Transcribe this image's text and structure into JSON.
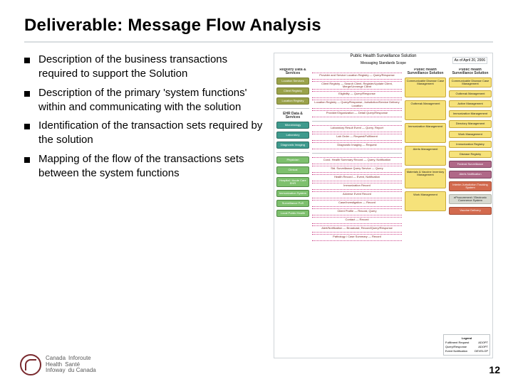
{
  "title": "Deliverable: Message Flow Analysis",
  "bullets": [
    "Description of the business transactions required to support the Solution",
    "Description of the primary 'system functions' within and communicating with the solution",
    "Identification of the transaction sets required by the solution",
    "Mapping of the flow of the transactions sets between the system functions"
  ],
  "diagram": {
    "date_box": "As of April 20, 2006",
    "heading": "Public Health Surveillance Solution",
    "subheading": "Messaging Standards Scope",
    "col1_header": "Registry Data & Services",
    "col3_header": "Public Health Surveillance Solution",
    "col1_blocks_a": [
      "Location Services",
      "Client Registry",
      "Location Registry"
    ],
    "col1_blocks_b": [
      "Microbiology",
      "Laboratory",
      "Diagnostic Imaging"
    ],
    "col1_section_b_header": "EHR Data & Services",
    "col1_blocks_c": [
      "Physician",
      "Clinical",
      "Hospital / Acute Care EHR",
      "Immunization System",
      "Surveillance PoS",
      "Local Public Health"
    ],
    "col2_msgs_a": [
      "Provider and Service Location Registry — Query/Response",
      "Client Registry — Search Client, Register/Update Client, Merge/Unmerge Client",
      "Eligibility — Query/Response",
      "Location Registry — Query/Response, Jurisdiction/Service Delivery Location",
      "Provider/Organization — Detail Query/Response"
    ],
    "col2_msgs_b": [
      "Laboratory Result Event — Query, Report",
      "Lab Order — Request/Fulfilment",
      "Diagnostic Imaging — Request"
    ],
    "col2_msgs_c": [
      "Cond. Health Summary Record — Query, Notification",
      "Std. Surveillance Query Service — Query",
      "Health Record — Event, Notification",
      "Immunization Record",
      "Adverse Event Record",
      "Case/Investigation — Record",
      "Client Profile — Record, Query",
      "Contact — Record",
      "Alert/Notification — Broadcast, Record/Query/Response",
      "Pathology / Case Summary — Record"
    ],
    "col3_blocks": [
      "Communicable Disease Case Management",
      "Outbreak Management",
      "Immunization Management",
      "Alerts Management",
      "Materials & Vaccine Inventory Management",
      "Work Management"
    ],
    "col4_blocks": [
      "Communicable Disease Case Management",
      "Outbreak Management",
      "Active Management",
      "Immunization Management",
      "Directory Management",
      "Work Management",
      "Immunization Registry",
      "Disease Registry",
      "Federal Surveillance",
      "Alerts Notification",
      "Interim Jurisdiction Tracking System",
      "eProcurement / Electronic Commerce System",
      "Vaccine Delivery"
    ],
    "col4_header": "Public Health Surveillance Solution",
    "legend": {
      "title": "Legend",
      "rows": [
        [
          "Fulfilment Request",
          "ADOPT"
        ],
        [
          "Query/Response",
          "ADOPT"
        ],
        [
          "Event Notification",
          "DEVELOP"
        ]
      ]
    }
  },
  "footer": {
    "brand_en_1": "Canada",
    "brand_en_2": "Health",
    "brand_en_3": "Infoway",
    "brand_fr_1": "Inforoute",
    "brand_fr_2": "Santé",
    "brand_fr_3": "du Canada"
  },
  "page_number": "12"
}
